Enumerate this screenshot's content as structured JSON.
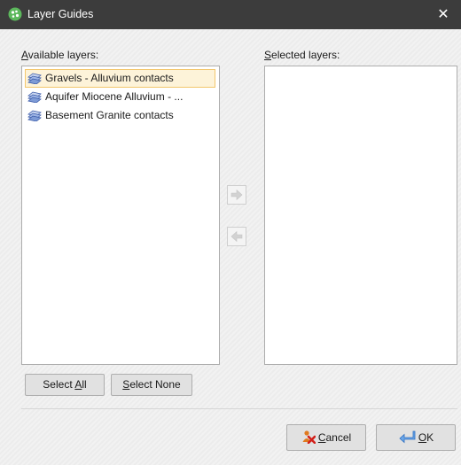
{
  "window": {
    "title": "Layer Guides",
    "close_glyph": "✕"
  },
  "available": {
    "label_pre": "",
    "label_u": "A",
    "label_post": "vailable layers:",
    "items": [
      {
        "label": "Gravels - Alluvium contacts",
        "selected": true,
        "icon": "layer-guide-icon"
      },
      {
        "label": "Aquifer Miocene Alluvium - ...",
        "selected": false,
        "icon": "layer-guide-icon"
      },
      {
        "label": "Basement Granite contacts",
        "selected": false,
        "icon": "layer-guide-icon"
      }
    ]
  },
  "selected": {
    "label_pre": "",
    "label_u": "S",
    "label_post": "elected layers:",
    "items": []
  },
  "buttons": {
    "select_all_pre": "Select ",
    "select_all_u": "A",
    "select_all_post": "ll",
    "select_none_pre": "",
    "select_none_u": "S",
    "select_none_post": "elect None",
    "cancel_pre": "",
    "cancel_u": "C",
    "cancel_post": "ancel",
    "ok_pre": "",
    "ok_u": "O",
    "ok_post": "K"
  },
  "colors": {
    "titlebar": "#3c3c3c",
    "selection_fill": "#fdf3d9",
    "selection_border": "#f3c66c",
    "app_icon": "#5cb85c"
  }
}
